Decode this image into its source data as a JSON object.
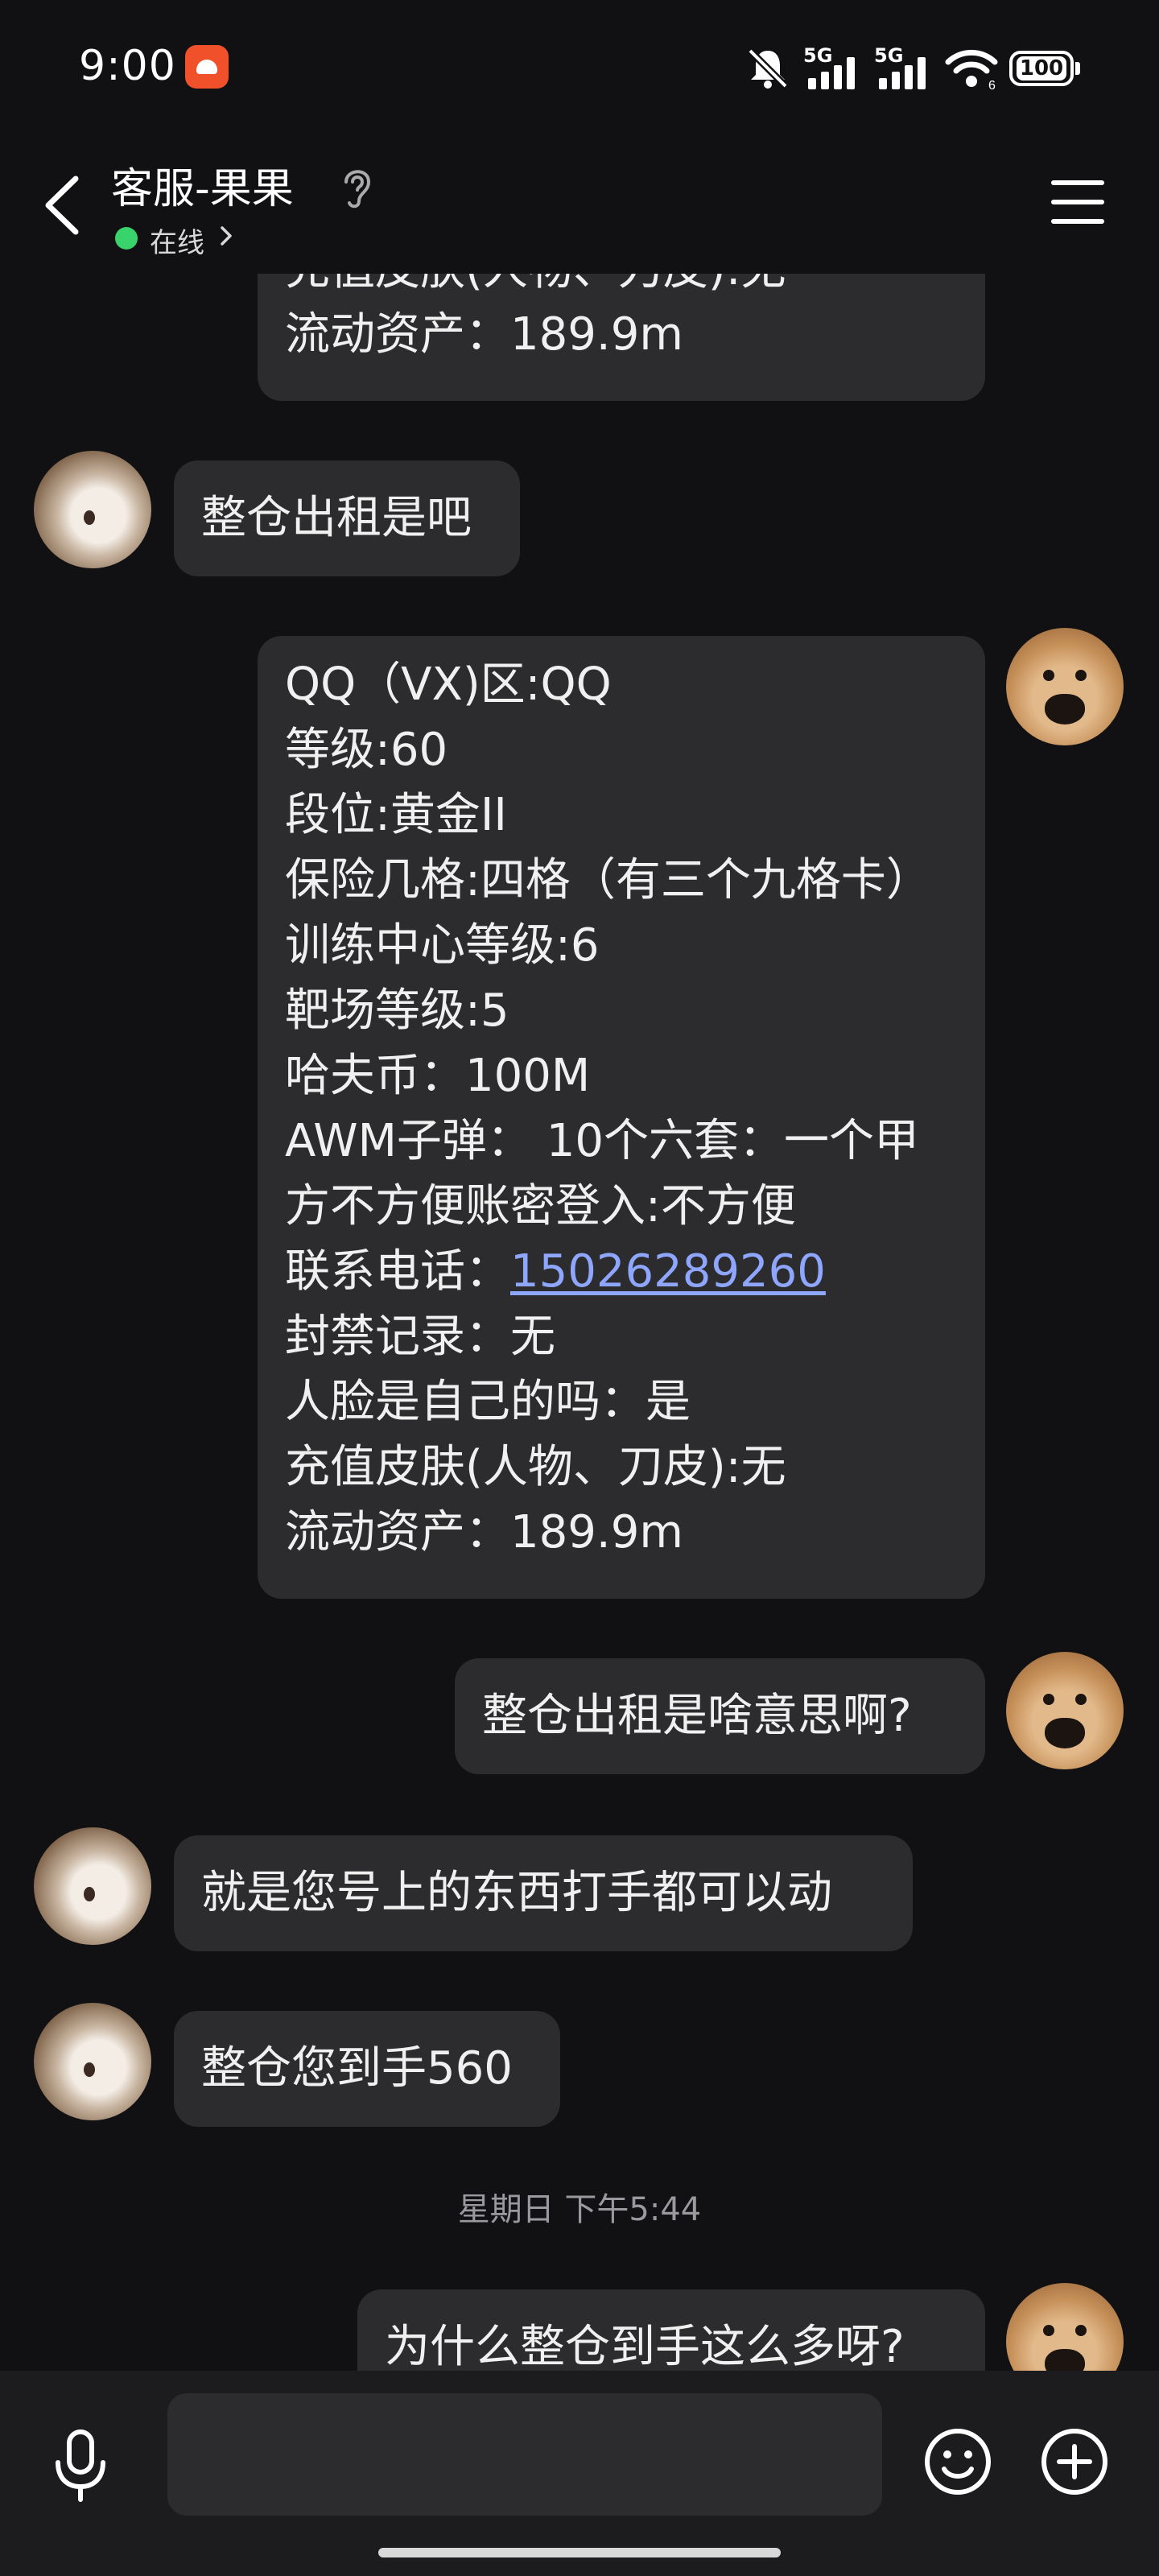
{
  "status_bar": {
    "time": "9:00",
    "network_1": "5G",
    "network_2": "5G",
    "wifi_badge": "6",
    "battery": "100"
  },
  "header": {
    "title": "客服-果果",
    "status": "在线"
  },
  "messages": {
    "m1_lines": [
      "充值皮肤(人物、刀皮):无",
      "流动资产：189.9m"
    ],
    "m2_text": "整仓出租是吧",
    "m3": {
      "l1": "QQ（VX)区:QQ",
      "l2": "等级:60",
      "l3": "段位:黄金II",
      "l4": "保险几格:四格（有三个九格卡）",
      "l5": "训练中心等级:6",
      "l6": "靶场等级:5",
      "l7": "哈夫币：100M",
      "l8": "AWM子弹： 10个六套：一个甲",
      "l9": "方不方便账密登入:不方便",
      "l10_label": "联系电话：",
      "l10_phone": "15026289260",
      "l11": "封禁记录：无",
      "l12": "人脸是自己的吗：是",
      "l13": "充值皮肤(人物、刀皮):无",
      "l14": "流动资产：189.9m"
    },
    "m4_text": "整仓出租是啥意思啊?",
    "m5_text": "就是您号上的东西打手都可以动",
    "m6_text": "整仓您到手560",
    "timestamp": "星期日 下午5:44",
    "m7_text": "为什么整仓到手这么多呀?"
  },
  "icons": {
    "back": "chevron-left-icon",
    "ear": "ear-icon",
    "menu": "hamburger-menu-icon",
    "mic": "microphone-icon",
    "emoji": "smiley-icon",
    "plus": "plus-circle-icon"
  },
  "colors": {
    "background": "#111113",
    "bubble": "#2c2c2e",
    "online": "#39d36b",
    "link": "#8fa6ff"
  }
}
